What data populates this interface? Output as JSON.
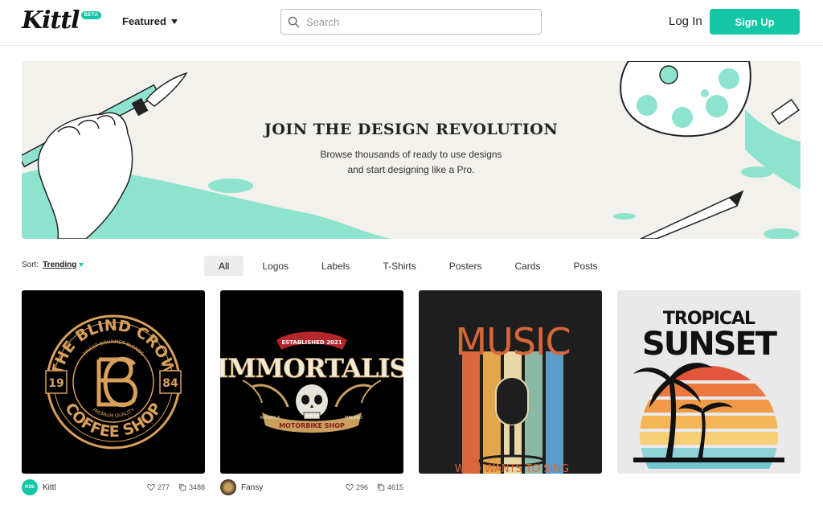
{
  "header": {
    "logo_text": "Kittl",
    "beta_badge": "BETA",
    "featured_label": "Featured",
    "search_placeholder": "Search",
    "login_label": "Log In",
    "signup_label": "Sign Up",
    "accent_color": "#13c7a6"
  },
  "banner": {
    "title": "JOIN THE DESIGN REVOLUTION",
    "subtitle_line1": "Browse thousands of ready to use designs",
    "subtitle_line2": "and start designing like a Pro."
  },
  "filters": {
    "sort_label": "Sort:",
    "sort_value": "Trending",
    "tabs": [
      "All",
      "Logos",
      "Labels",
      "T-Shirts",
      "Posters",
      "Cards",
      "Posts"
    ],
    "active_tab": "All"
  },
  "cards": [
    {
      "author": "Kittl",
      "likes": "277",
      "copies": "3488",
      "design": {
        "top_text": "THE BLIND CROW",
        "bottom_text": "COFFEE SHOP",
        "left_num": "19",
        "right_num": "84",
        "ring_top": "FINEST GOURMET BLENDS",
        "ring_bottom": "PREMIUM QUALITY"
      }
    },
    {
      "author": "Fansy",
      "likes": "296",
      "copies": "4615",
      "design": {
        "ribbon": "ESTABLISHED 2021",
        "title": "IMMORTALIS",
        "banner": "MOTORBIKE SHOP",
        "left_small": "ROUVOLA",
        "right_small": "FINLAND"
      }
    },
    {
      "design": {
        "title": "MUSIC",
        "bottom": "WHO WANTS TO SING"
      }
    },
    {
      "design": {
        "title_top": "TROPICAL",
        "title_main": "SUNSET"
      }
    }
  ]
}
